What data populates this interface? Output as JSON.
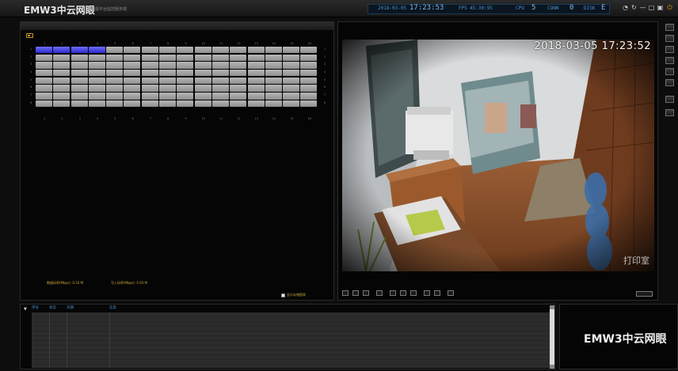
{
  "app": {
    "brand": "EMW3中云网眼",
    "brand_sub": "变电视平台监控服务端"
  },
  "status": {
    "date": "2018-03-05",
    "time": "17:23:53",
    "fps_label": "FPS",
    "fps_value": "45:30:95",
    "cpu_label": "CPU",
    "cpu_value": "5",
    "conn_label": "CONN",
    "conn_value": "0",
    "disk_label": "DISK",
    "disk_value": "E"
  },
  "window_buttons": [
    "restore-icon",
    "refresh-icon",
    "minimize-icon",
    "maximize-icon",
    "lock-icon",
    "power-icon"
  ],
  "recording_grid": {
    "columns": [
      "1",
      "2",
      "3",
      "4",
      "5",
      "6",
      "7",
      "8",
      "9",
      "10",
      "11",
      "12",
      "13",
      "14",
      "15",
      "16"
    ],
    "rows": [
      "1",
      "2",
      "3",
      "4",
      "5",
      "6",
      "7",
      "8"
    ],
    "active_row": 1,
    "active_cells": 4
  },
  "speeds": {
    "read_label": "数据码率(Mbps):",
    "read_value": "0.33 M",
    "write_label": "写入码率(Mbps):",
    "write_value": "0.93 M"
  },
  "show_speed_label": "显示存储图表",
  "video": {
    "timestamp": "2018-03-05 17:23:52",
    "sign": "打印室"
  },
  "log": {
    "columns": [
      "序号",
      "状态",
      "日期",
      "信息"
    ]
  },
  "logo": "EMW3中云网眼",
  "colors": {
    "accent_blue": "#4e8fd0",
    "active_cell": "#3b3bff",
    "gold": "#c9a83a"
  }
}
